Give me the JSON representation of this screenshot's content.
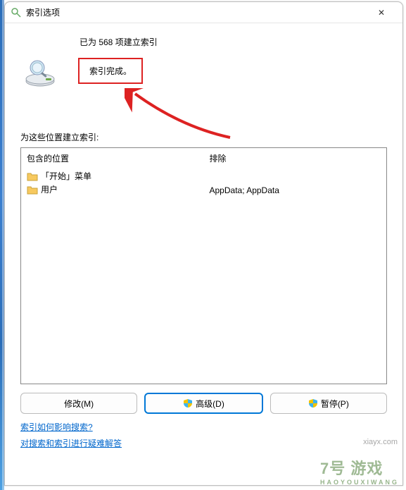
{
  "window": {
    "title": "索引选项",
    "close_glyph": "✕"
  },
  "status": {
    "line1": "已为 568 项建立索引",
    "complete": "索引完成。"
  },
  "section_label": "为这些位置建立索引:",
  "columns": {
    "included_header": "包含的位置",
    "excluded_header": "排除"
  },
  "locations": [
    {
      "label": "「开始」菜单"
    },
    {
      "label": "用户"
    }
  ],
  "excluded_text": "AppData; AppData",
  "buttons": {
    "modify": "修改(M)",
    "advanced": "高级(D)",
    "pause": "暂停(P)"
  },
  "links": {
    "help1": "索引如何影响搜索?",
    "help2": "对搜索和索引进行疑难解答"
  },
  "watermark": {
    "brand": "7号 游戏",
    "pinyin": "HAOYOUXIWANG",
    "url": "xiayx.com"
  }
}
